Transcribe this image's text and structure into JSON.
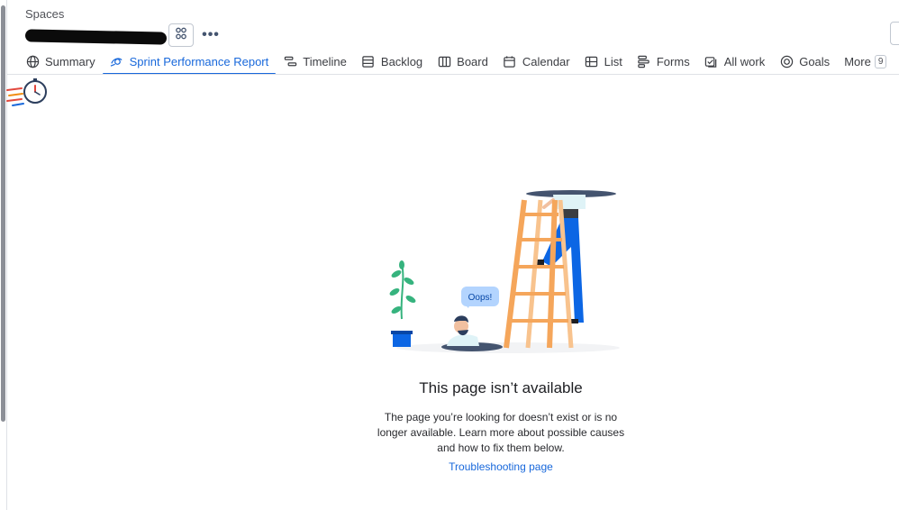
{
  "breadcrumb": {
    "label": "Spaces"
  },
  "header": {
    "people_icon": "people-icon",
    "more_icon": "more-horizontal-icon"
  },
  "tabs": [
    {
      "label": "Summary",
      "icon": "globe-icon"
    },
    {
      "label": "Sprint Performance Report",
      "icon": "sprint-report-icon",
      "active": true
    },
    {
      "label": "Timeline",
      "icon": "timeline-icon"
    },
    {
      "label": "Backlog",
      "icon": "backlog-icon"
    },
    {
      "label": "Board",
      "icon": "board-icon"
    },
    {
      "label": "Calendar",
      "icon": "calendar-icon"
    },
    {
      "label": "List",
      "icon": "list-icon"
    },
    {
      "label": "Forms",
      "icon": "forms-icon"
    },
    {
      "label": "All work",
      "icon": "all-work-icon"
    },
    {
      "label": "Goals",
      "icon": "goals-icon"
    },
    {
      "label": "More",
      "badge": "9"
    }
  ],
  "illustration": {
    "speech": "Oops!"
  },
  "error": {
    "title": "This page isn’t available",
    "body": "The page you’re looking for doesn’t exist or is no longer available. Learn more about possible causes and how to fix them below.",
    "link": "Troubleshooting page"
  },
  "colors": {
    "accent": "#1868db",
    "ladder": "#f5a65b",
    "plant": "#36b37e",
    "pot": "#0c66e4"
  }
}
